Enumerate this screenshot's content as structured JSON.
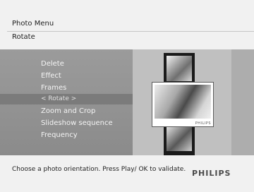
{
  "header": {
    "title": "Photo Menu",
    "subtitle": "Rotate"
  },
  "menu": {
    "items": [
      "Delete",
      "Effect",
      "Frames",
      "< Rotate >",
      "Zoom and Crop",
      "Slideshow sequence",
      "Frequency"
    ],
    "selected_index": 3
  },
  "preview": {
    "brand": "PHILIPS"
  },
  "footer": {
    "instruction": "Choose a photo orientation. Press Play/ OK to validate.",
    "logo": "PHILIPS"
  }
}
